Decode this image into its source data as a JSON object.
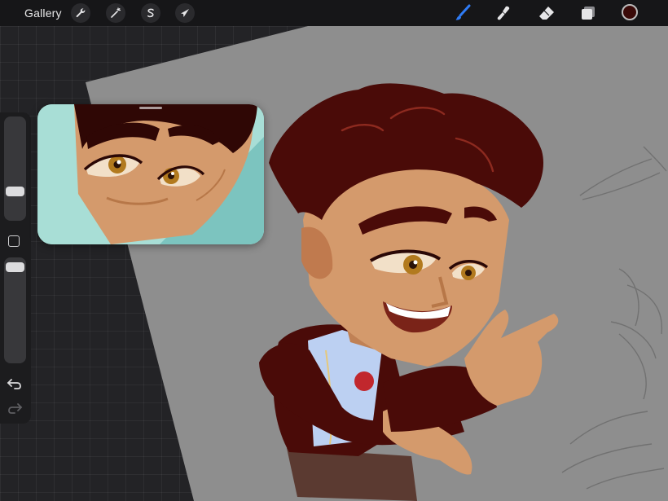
{
  "topbar": {
    "gallery_label": "Gallery",
    "left_tools": [
      "wrench-icon",
      "magic-wand-icon",
      "selection-s-icon",
      "transform-arrow-icon"
    ],
    "right_tools": [
      "brush-icon",
      "smudge-icon",
      "eraser-icon",
      "layers-icon"
    ],
    "active_tool": "brush-icon",
    "accent_color": "#2f7cf6",
    "current_color": "#3a0a08"
  },
  "sidebar": {
    "brush_size_level": 0.4,
    "opacity_level": 0.95,
    "undo_icon": "undo-arrow-icon",
    "redo_icon": "redo-arrow-icon"
  },
  "colors": {
    "canvas": "#8e8e8e",
    "hair": "#4a0b08",
    "skin": "#d49a6c",
    "reference_bg": "#a8ded6"
  }
}
